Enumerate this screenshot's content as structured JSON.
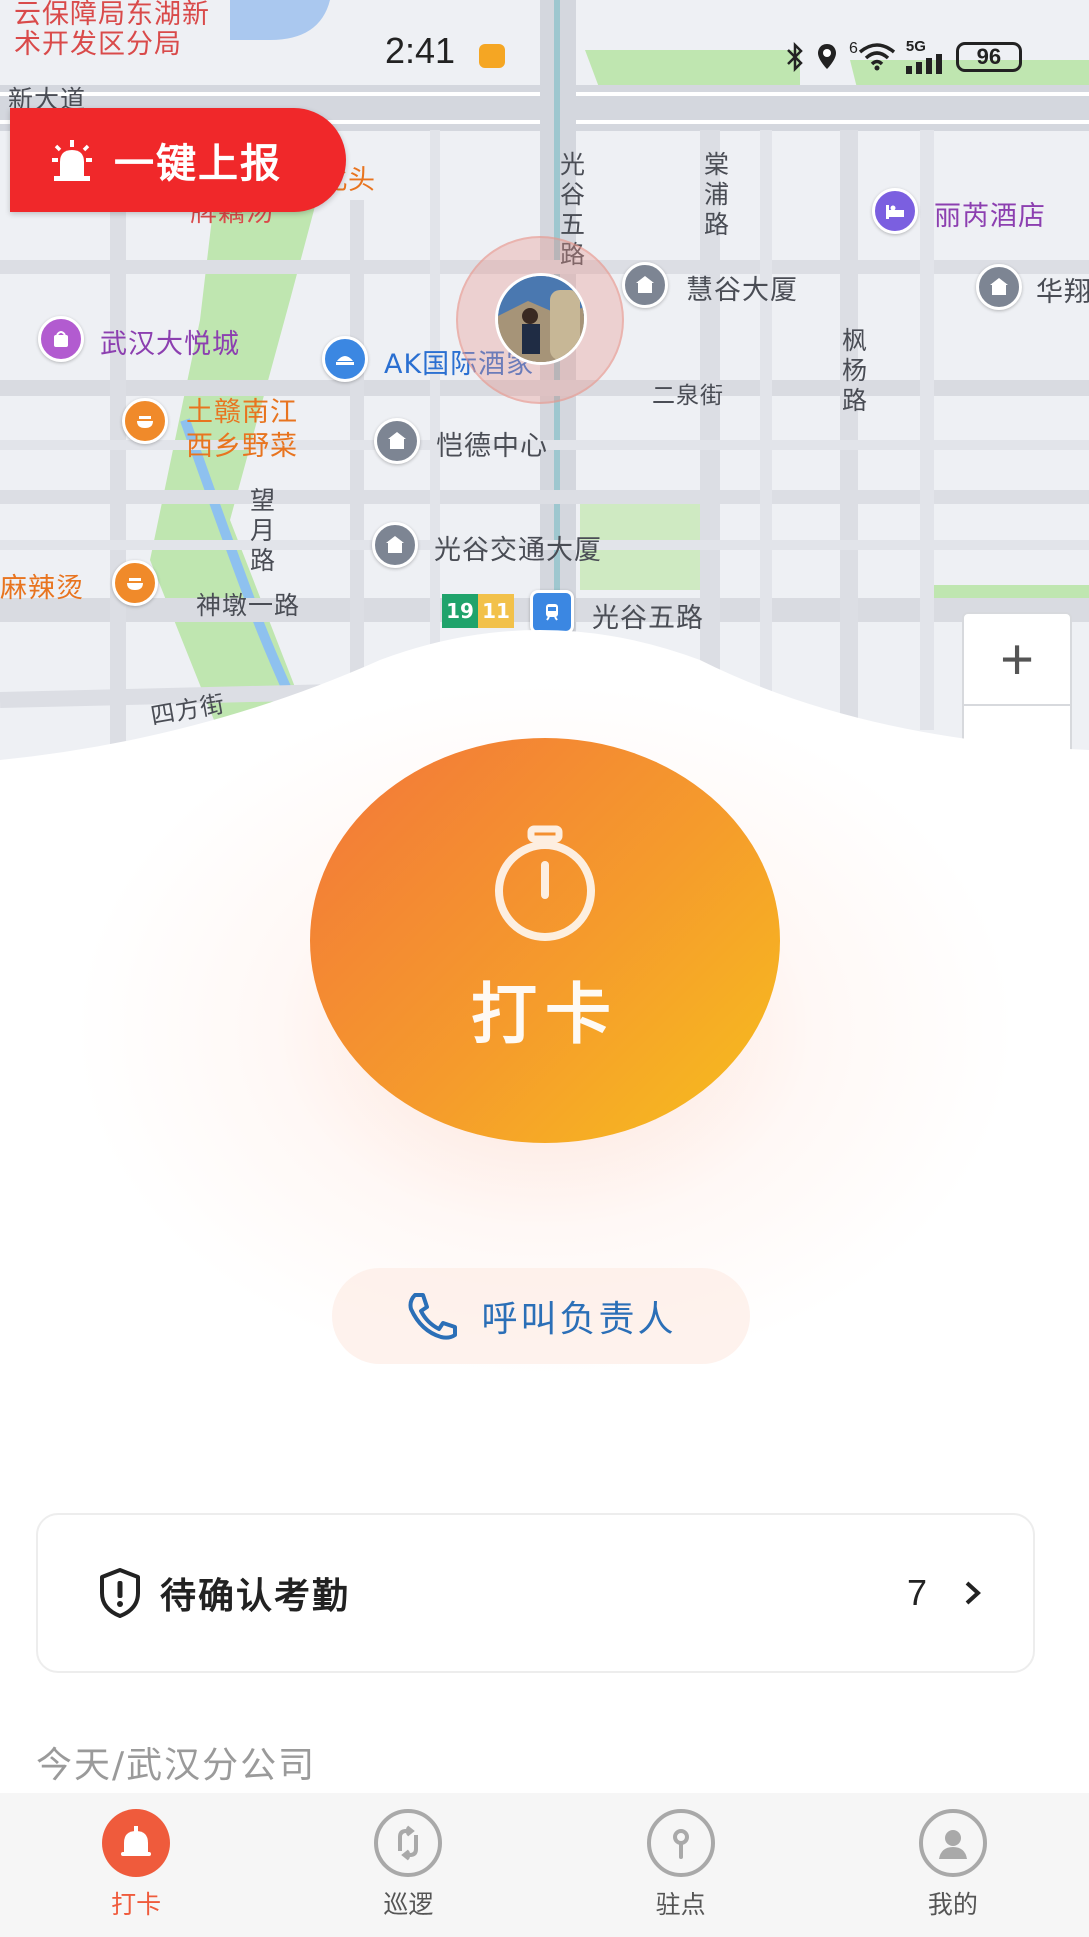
{
  "status_bar": {
    "time": "2:41",
    "network": "5G",
    "signal_sup": "6",
    "battery": "96"
  },
  "map": {
    "labels": {
      "top_left_1": "云保障局东湖新",
      "top_left_2": "术开发区分局",
      "xin_da_dao": "新大道",
      "bei_tou": "北头",
      "ou_tang": "牌藕汤",
      "guanggu_wu_lu_vert": "光谷五路",
      "tang_pu_lu": "棠浦路",
      "lixuan_hotel": "丽芮酒店",
      "huigu_building": "慧谷大厦",
      "hua_partial": "华翔",
      "wuhan_joy_city": "武汉大悦城",
      "ak_intl": "AK国际酒家",
      "fengyang_lu": "枫杨路",
      "erquan_jie": "二泉街",
      "restaurant_1": "土赣南江",
      "restaurant_2": "西乡野菜",
      "kaide_center": "恺德中心",
      "wangyue_lu": "望月路",
      "guanggu_traffic": "光谷交通大厦",
      "malatang": "麻辣烫",
      "shendun_yi_lu": "神墩一路",
      "metro_station": "光谷五路",
      "sifang_jie": "四方街"
    },
    "metro_lines": [
      "19",
      "11"
    ],
    "metro_colors": [
      "#1fa36b",
      "#f2c14a"
    ],
    "zoom_in": "+",
    "zoom_out": "−"
  },
  "report_button": {
    "label": "一键上报",
    "icon": "alarm-light-icon"
  },
  "checkin": {
    "label": "打卡",
    "icon": "stopwatch-icon"
  },
  "call_button": {
    "label": "呼叫负责人",
    "icon": "phone-icon"
  },
  "pending": {
    "title": "待确认考勤",
    "count": "7",
    "icon": "shield-alert-icon"
  },
  "today_label": "今天/武汉分公司",
  "tabbar": {
    "tabs": [
      {
        "label": "打卡",
        "icon": "bell-icon",
        "active": true
      },
      {
        "label": "巡逻",
        "icon": "patrol-route-icon",
        "active": false
      },
      {
        "label": "驻点",
        "icon": "pin-icon",
        "active": false
      },
      {
        "label": "我的",
        "icon": "profile-icon",
        "active": false
      }
    ]
  },
  "colors": {
    "accent": "#ef5b3c",
    "report_red": "#f0282a",
    "call_blue": "#2b6fb7"
  }
}
